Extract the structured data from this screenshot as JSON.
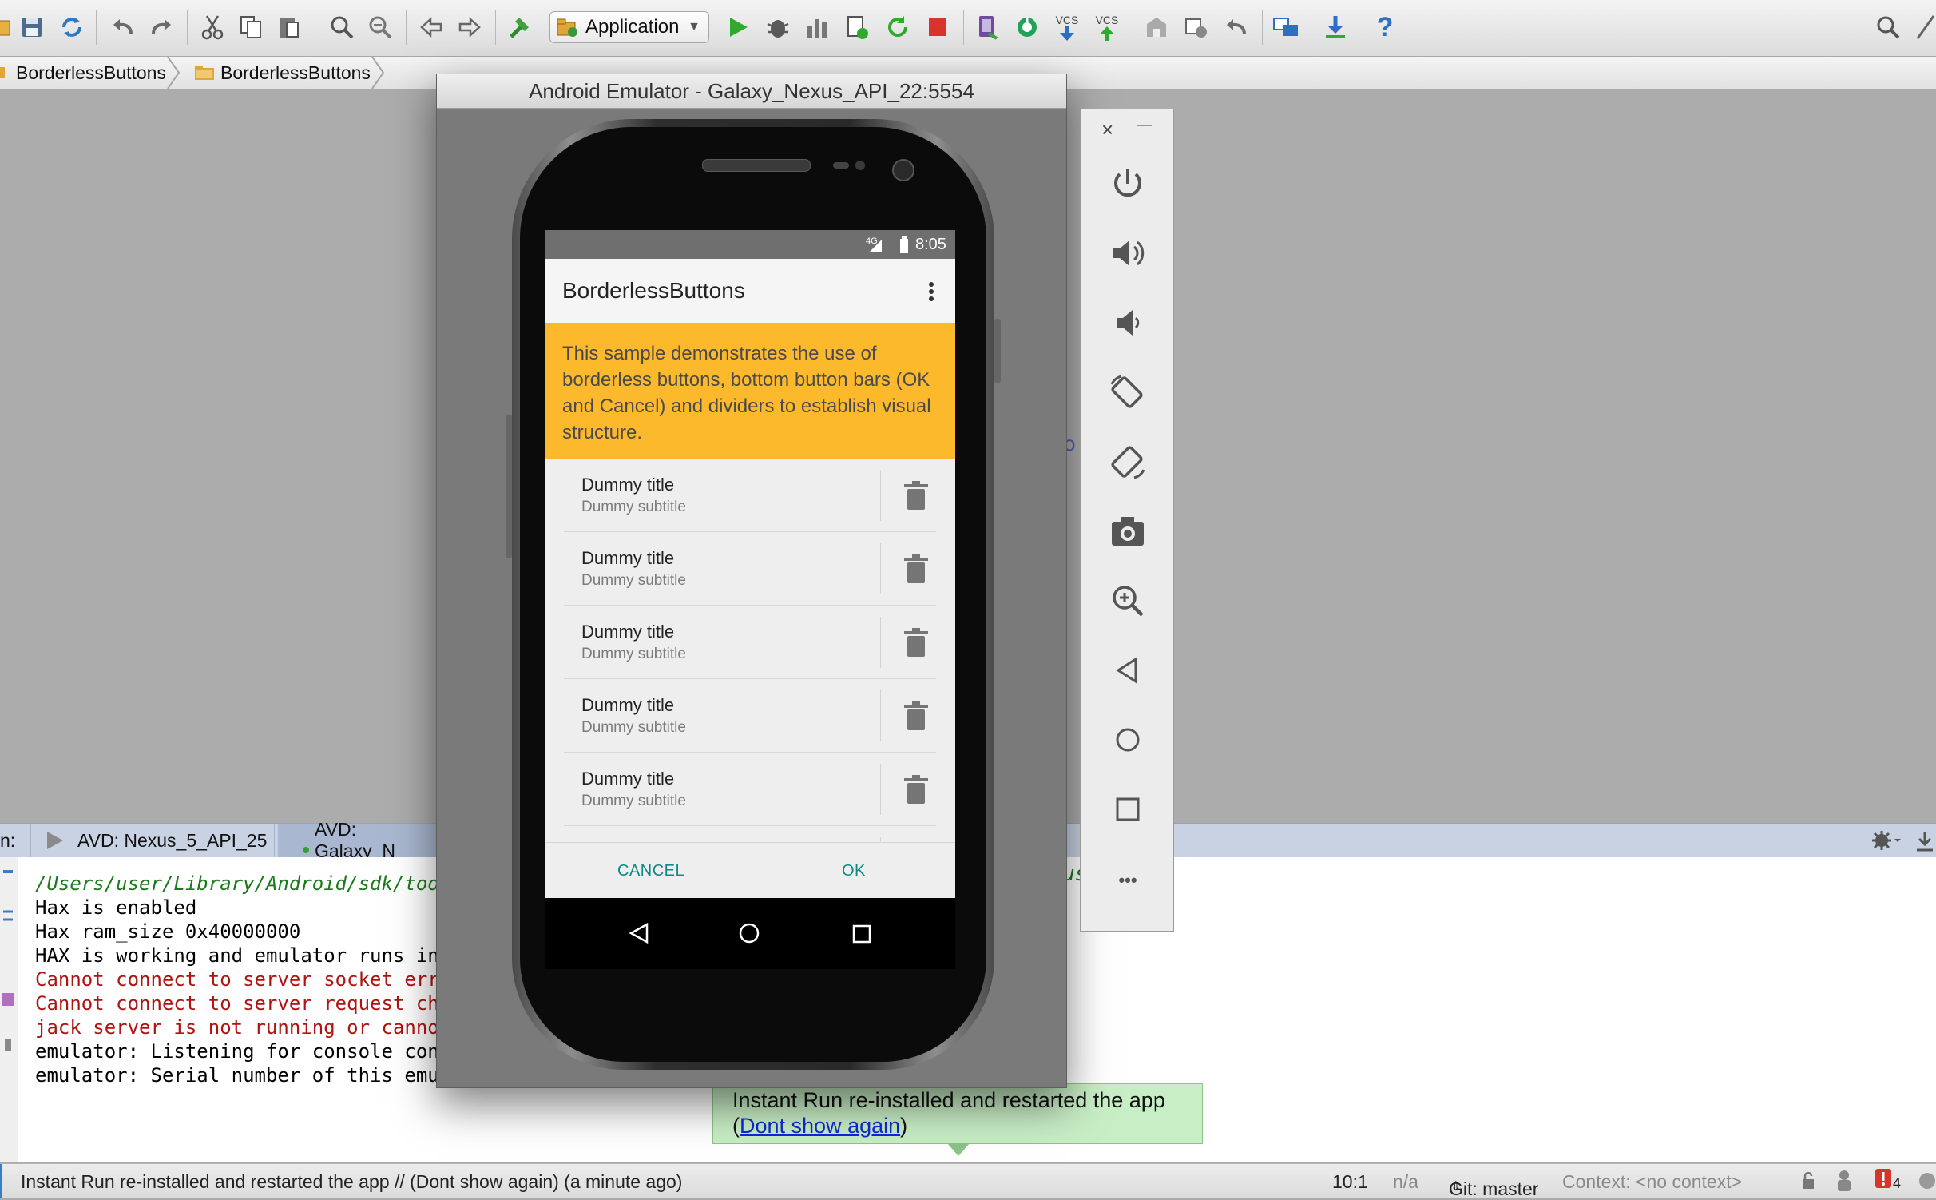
{
  "toolbar": {
    "run_config": "Application",
    "vcs_label_1": "VCS",
    "vcs_label_2": "VCS",
    "help_label": "?"
  },
  "breadcrumb": {
    "items": [
      "BorderlessButtons",
      "BorderlessButtons"
    ]
  },
  "run_window": {
    "prefix": "n:",
    "tabs": [
      "AVD: Nexus_5_API_25",
      "AVD: Galaxy_N"
    ],
    "console_lines": [
      {
        "text": "/Users/user/Library/Android/sdk/tool",
        "type": "path"
      },
      {
        "text": "Hax is enabled",
        "type": "normal"
      },
      {
        "text": "Hax ram_size 0x40000000",
        "type": "normal"
      },
      {
        "text": "HAX is working and emulator runs in",
        "type": "normal"
      },
      {
        "text": "Cannot connect to server socket err",
        "type": "error"
      },
      {
        "text": "Cannot connect to server request cha",
        "type": "error"
      },
      {
        "text": "jack server is not running or cannot",
        "type": "error"
      },
      {
        "text": "emulator: Listening for console conn",
        "type": "normal"
      },
      {
        "text": "emulator: Serial number of this emul",
        "type": "normal"
      }
    ],
    "behind_fragment_1": "o",
    "behind_fragment_2": "us"
  },
  "status_bar": {
    "message": "Instant Run re-installed and restarted the app // (Dont show again) (a minute ago)",
    "position": "10:1",
    "na": "n/a",
    "git": "Git: master",
    "context": "Context: <no context>",
    "problems": "4"
  },
  "balloon": {
    "text": "Instant Run re-installed and restarted the app",
    "open_paren": "(",
    "link": "Dont show again",
    "close_paren": ")"
  },
  "emulator": {
    "title": "Android Emulator - Galaxy_Nexus_API_22:5554",
    "status_time": "8:05",
    "network": "4G",
    "app_title": "BorderlessButtons",
    "intro": "This sample demonstrates the use of borderless buttons, bottom button bars (OK and Cancel) and dividers to establish visual structure.",
    "items": [
      {
        "title": "Dummy title",
        "subtitle": "Dummy subtitle"
      },
      {
        "title": "Dummy title",
        "subtitle": "Dummy subtitle"
      },
      {
        "title": "Dummy title",
        "subtitle": "Dummy subtitle"
      },
      {
        "title": "Dummy title",
        "subtitle": "Dummy subtitle"
      },
      {
        "title": "Dummy title",
        "subtitle": "Dummy subtitle"
      }
    ],
    "cancel": "CANCEL",
    "ok": "OK"
  },
  "emu_panel": {
    "close": "×",
    "minimize": "—",
    "more": "•••"
  },
  "colors": {
    "accent_orange": "#fdb92c",
    "button_teal": "#0e8a85",
    "balloon_green": "#c8eec5",
    "error_red": "#b11212"
  }
}
